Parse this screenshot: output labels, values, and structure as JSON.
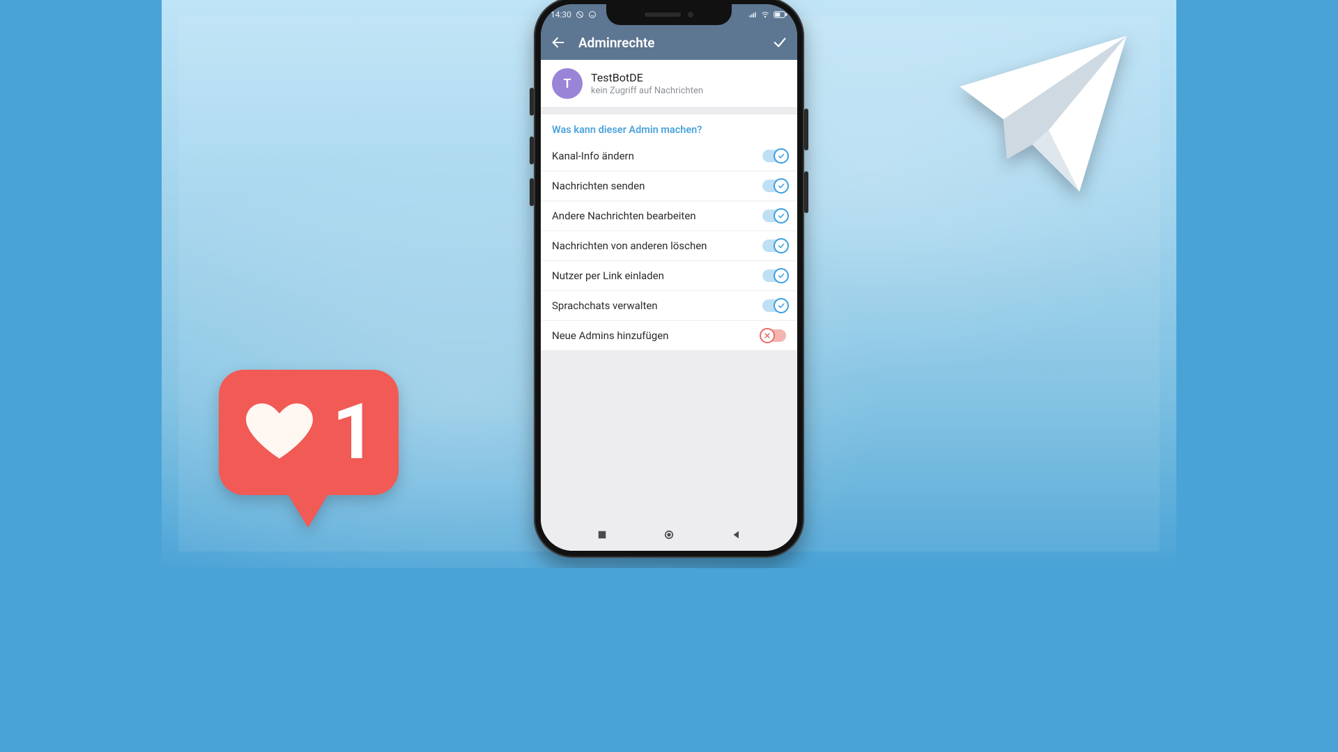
{
  "stage": {
    "like_count": "1"
  },
  "statusbar": {
    "time": "14:30"
  },
  "appbar": {
    "title": "Adminrechte"
  },
  "user": {
    "avatar_letter": "T",
    "name": "TestBotDE",
    "subtitle": "kein Zugriff auf Nachrichten"
  },
  "section": {
    "header": "Was kann dieser Admin machen?"
  },
  "perms": [
    {
      "label": "Kanal-Info ändern",
      "on": true
    },
    {
      "label": "Nachrichten senden",
      "on": true
    },
    {
      "label": "Andere Nachrichten bearbeiten",
      "on": true
    },
    {
      "label": "Nachrichten von anderen löschen",
      "on": true
    },
    {
      "label": "Nutzer per Link einladen",
      "on": true
    },
    {
      "label": "Sprachchats verwalten",
      "on": true
    },
    {
      "label": "Neue Admins hinzufügen",
      "on": false
    }
  ],
  "colors": {
    "bg_blue": "#4aa3d6",
    "like_red": "#f15a55",
    "appbar_blue": "#5d7691",
    "accent_blue": "#3b9fdd",
    "accent_red": "#e86b63",
    "avatar_purple": "#9a84d6"
  }
}
